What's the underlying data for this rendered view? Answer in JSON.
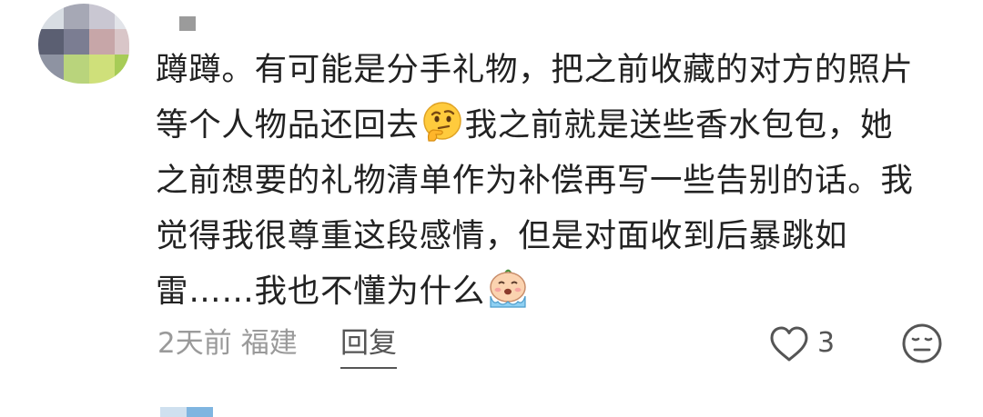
{
  "comment": {
    "lines": [
      "蹲蹲。有可能是分手礼物，把之前收藏的对方的照片",
      "等个人物品还回去",
      "我之前就是送些香水包包，她",
      "之前想要的礼物清单作为补偿再写一些告别的话。我",
      "觉得我很尊重这段感情，但是对面收到后暴跳如",
      "雷……我也不懂为什么"
    ],
    "emoji_1": "thinking-face-emoji",
    "emoji_2": "crying-face-emoji"
  },
  "meta": {
    "time": "2天前",
    "location": "福建",
    "reply_label": "回复",
    "like_count": "3"
  },
  "icons": {
    "like": "heart-outline-icon",
    "reaction": "meh-face-icon"
  },
  "colors": {
    "text": "#222222",
    "meta_text": "#9a9a9a",
    "icon": "#555555"
  }
}
